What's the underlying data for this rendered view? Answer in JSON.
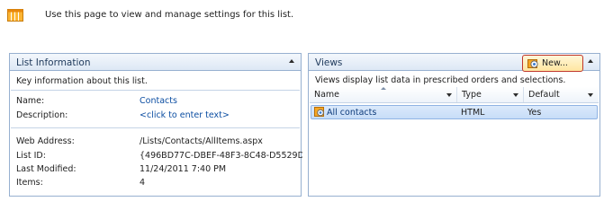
{
  "intro": {
    "text": "Use this page to view and manage settings for this list."
  },
  "list_information": {
    "title": "List Information",
    "subtitle": "Key information about this list.",
    "fields": [
      {
        "label": "Name:",
        "value": "Contacts"
      },
      {
        "label": "Description:",
        "value": "<click to enter text>"
      },
      {
        "label": "Web Address:",
        "value": "/Lists/Contacts/AllItems.aspx"
      },
      {
        "label": "List ID:",
        "value": "{496BD77C-DBEF-48F3-8C48-D5529D"
      },
      {
        "label": "Last Modified:",
        "value": "11/24/2011 7:40 PM"
      },
      {
        "label": "Items:",
        "value": "4"
      }
    ]
  },
  "views": {
    "title": "Views",
    "new_button_label": "New...",
    "subtitle": "Views display list data in prescribed orders and selections.",
    "columns": [
      "Name",
      "Type",
      "Default"
    ],
    "rows": [
      {
        "name": "All contacts",
        "type": "HTML",
        "default": "Yes"
      }
    ]
  },
  "colors": {
    "panel_border": "#97b0d0",
    "header_title": "#1e395b",
    "link": "#0c4ea2",
    "selection": "#c7ddf8",
    "highlight_outline": "#c0372b"
  },
  "icons": [
    "list-settings-icon",
    "new-view-icon",
    "view-icon",
    "collapse-icon",
    "dropdown-icon"
  ]
}
